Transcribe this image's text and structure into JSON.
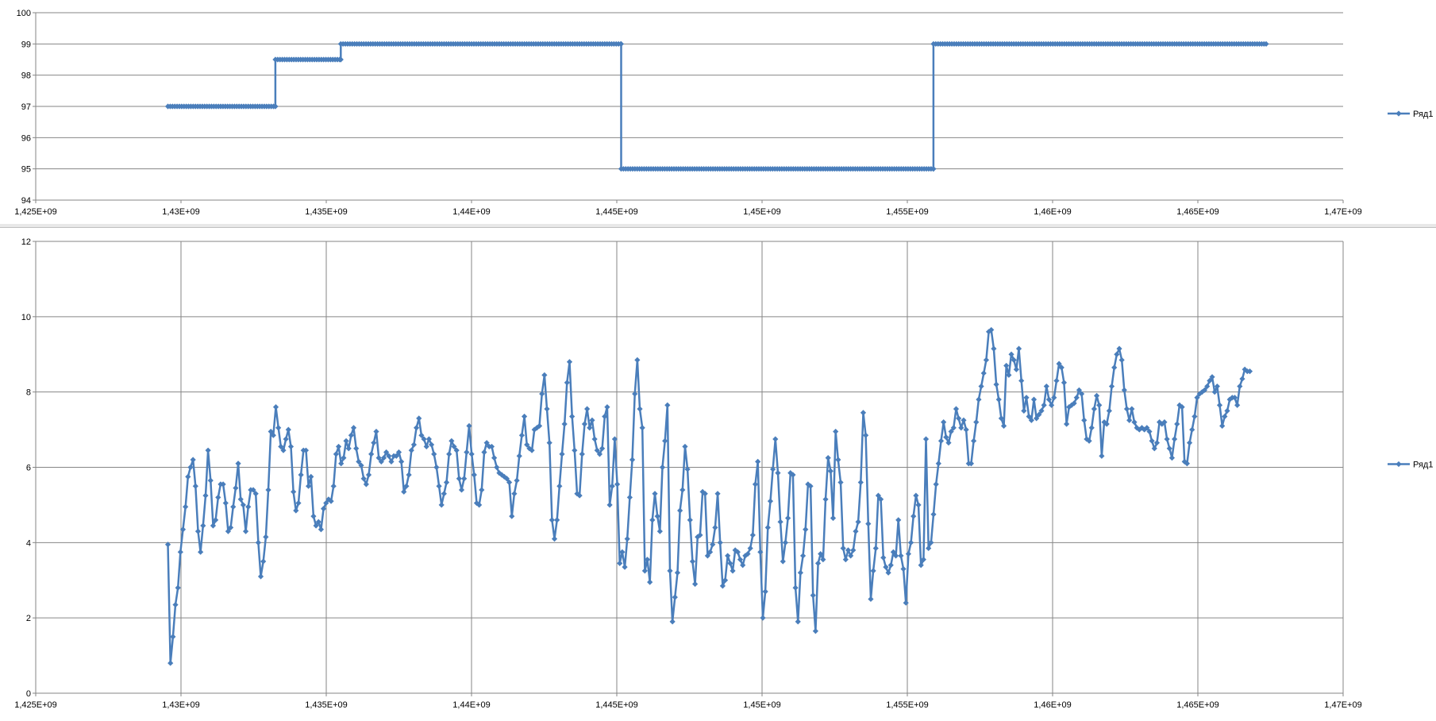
{
  "colors": {
    "series": "#4a7ebb",
    "grid": "#868686",
    "axis": "#868686"
  },
  "chart_data": [
    {
      "type": "line",
      "title": "",
      "xlabel": "",
      "ylabel": "",
      "xlim": [
        1425000000,
        1470000000
      ],
      "ylim": [
        94,
        100
      ],
      "grid": "horizontal",
      "legend_position": "right",
      "xtick_labels": [
        "1,425E+09",
        "1,43E+09",
        "1,435E+09",
        "1,44E+09",
        "1,445E+09",
        "1,45E+09",
        "1,455E+09",
        "1,46E+09",
        "1,465E+09",
        "1,47E+09"
      ],
      "ytick_labels": [
        "94",
        "95",
        "96",
        "97",
        "98",
        "99",
        "100"
      ],
      "series": [
        {
          "name": "Ряд1",
          "marker": "diamond",
          "x_start": 1429550000,
          "x_step": 79000,
          "steps": [
            {
              "x_from": 1429550000,
              "x_to": 1433250000,
              "y": 97
            },
            {
              "x_from": 1433250000,
              "x_to": 1435500000,
              "y": 98.5
            },
            {
              "x_from": 1435500000,
              "x_to": 1445150000,
              "y": 99
            },
            {
              "x_from": 1445150000,
              "x_to": 1455900000,
              "y": 95
            },
            {
              "x_from": 1455900000,
              "x_to": 1467350000,
              "y": 99
            }
          ]
        }
      ]
    },
    {
      "type": "line",
      "title": "",
      "xlabel": "",
      "ylabel": "",
      "xlim": [
        1425000000,
        1470000000
      ],
      "ylim": [
        0,
        12
      ],
      "grid": "both",
      "legend_position": "right",
      "xtick_labels": [
        "1,425E+09",
        "1,43E+09",
        "1,435E+09",
        "1,44E+09",
        "1,445E+09",
        "1,45E+09",
        "1,455E+09",
        "1,46E+09",
        "1,465E+09",
        "1,47E+09"
      ],
      "ytick_labels": [
        "0",
        "2",
        "4",
        "6",
        "8",
        "10",
        "12"
      ],
      "series": [
        {
          "name": "Ряд1",
          "marker": "diamond",
          "x_start": 1429550000,
          "x_step": 86400,
          "values": [
            3.95,
            0.8,
            1.5,
            2.35,
            2.8,
            3.75,
            4.35,
            4.95,
            5.75,
            6.0,
            6.2,
            5.5,
            4.3,
            3.75,
            4.45,
            5.25,
            6.45,
            5.65,
            4.45,
            4.6,
            5.2,
            5.55,
            5.55,
            5.05,
            4.3,
            4.4,
            4.95,
            5.45,
            6.1,
            5.15,
            5.0,
            4.3,
            4.95,
            5.4,
            5.4,
            5.3,
            4.0,
            3.1,
            3.5,
            4.15,
            5.4,
            6.95,
            6.85,
            7.6,
            7.05,
            6.55,
            6.45,
            6.75,
            7.0,
            6.55,
            5.35,
            4.85,
            5.05,
            5.8,
            6.45,
            6.45,
            5.5,
            5.75,
            4.7,
            4.45,
            4.55,
            4.35,
            4.9,
            5.05,
            5.15,
            5.1,
            5.5,
            6.35,
            6.55,
            6.1,
            6.25,
            6.7,
            6.5,
            6.85,
            7.05,
            6.5,
            6.15,
            6.05,
            5.7,
            5.55,
            5.8,
            6.35,
            6.65,
            6.95,
            6.25,
            6.15,
            6.25,
            6.4,
            6.3,
            6.15,
            6.3,
            6.3,
            6.4,
            6.15,
            5.35,
            5.5,
            5.8,
            6.45,
            6.6,
            7.05,
            7.3,
            6.85,
            6.75,
            6.55,
            6.75,
            6.6,
            6.35,
            6.0,
            5.5,
            5.0,
            5.3,
            5.6,
            6.35,
            6.7,
            6.55,
            6.45,
            5.7,
            5.4,
            5.7,
            6.4,
            7.1,
            6.35,
            5.8,
            5.05,
            5.0,
            5.4,
            6.4,
            6.65,
            6.55,
            6.55,
            6.25,
            6.0,
            5.85,
            5.8,
            5.75,
            5.7,
            5.6,
            4.7,
            5.3,
            5.65,
            6.3,
            6.85,
            7.35,
            6.6,
            6.5,
            6.45,
            7.0,
            7.05,
            7.1,
            7.95,
            8.45,
            7.55,
            6.65,
            4.6,
            4.1,
            4.6,
            5.5,
            6.35,
            7.15,
            8.25,
            8.8,
            7.35,
            6.45,
            5.3,
            5.25,
            6.35,
            7.15,
            7.55,
            7.05,
            7.25,
            6.75,
            6.45,
            6.35,
            6.5,
            7.35,
            7.6,
            5.0,
            5.5,
            6.75,
            5.55,
            3.45,
            3.75,
            3.35,
            4.1,
            5.2,
            6.2,
            7.95,
            8.85,
            7.55,
            7.05,
            3.25,
            3.55,
            2.95,
            4.6,
            5.3,
            4.7,
            4.3,
            6.0,
            6.7,
            7.65,
            3.25,
            1.9,
            2.55,
            3.2,
            4.85,
            5.4,
            6.55,
            5.95,
            4.6,
            3.5,
            2.9,
            4.15,
            4.2,
            5.35,
            5.3,
            3.65,
            3.75,
            3.95,
            4.4,
            5.3,
            4.0,
            2.85,
            3.0,
            3.65,
            3.45,
            3.25,
            3.8,
            3.75,
            3.55,
            3.4,
            3.65,
            3.7,
            3.85,
            4.2,
            5.55,
            6.15,
            3.75,
            2.0,
            2.7,
            4.4,
            5.1,
            5.95,
            6.75,
            5.85,
            4.55,
            3.5,
            4.0,
            4.65,
            5.85,
            5.8,
            2.8,
            1.9,
            3.2,
            3.65,
            4.35,
            5.55,
            5.5,
            2.6,
            1.65,
            3.45,
            3.7,
            3.55,
            5.15,
            6.25,
            5.9,
            4.65,
            6.95,
            6.2,
            5.6,
            3.85,
            3.55,
            3.8,
            3.65,
            3.8,
            4.3,
            4.55,
            5.6,
            7.45,
            6.85,
            4.5,
            2.5,
            3.25,
            3.85,
            5.25,
            5.15,
            3.6,
            3.35,
            3.2,
            3.4,
            3.75,
            3.65,
            4.6,
            3.65,
            3.3,
            2.4,
            3.7,
            4.0,
            4.7,
            5.25,
            5.0,
            3.4,
            3.55,
            6.75,
            3.85,
            4.0,
            4.75,
            5.55,
            6.1,
            6.7,
            7.2,
            6.8,
            6.65,
            6.95,
            7.05,
            7.55,
            7.3,
            7.05,
            7.25,
            7.0,
            6.1,
            6.1,
            6.7,
            7.2,
            7.8,
            8.15,
            8.5,
            8.85,
            9.6,
            9.65,
            9.15,
            8.2,
            7.8,
            7.3,
            7.1,
            8.7,
            8.45,
            9.0,
            8.85,
            8.6,
            9.15,
            8.3,
            7.5,
            7.85,
            7.35,
            7.25,
            7.8,
            7.3,
            7.4,
            7.5,
            7.65,
            8.15,
            7.8,
            7.65,
            7.85,
            8.3,
            8.75,
            8.65,
            8.25,
            7.15,
            7.6,
            7.65,
            7.7,
            7.85,
            8.05,
            7.95,
            7.25,
            6.75,
            6.7,
            7.05,
            7.55,
            7.9,
            7.65,
            6.3,
            7.2,
            7.15,
            7.5,
            8.15,
            8.65,
            9.0,
            9.15,
            8.85,
            8.05,
            7.55,
            7.25,
            7.55,
            7.2,
            7.05,
            7.0,
            7.05,
            7.0,
            7.05,
            6.95,
            6.7,
            6.5,
            6.65,
            7.2,
            7.15,
            7.2,
            6.75,
            6.5,
            6.25,
            6.75,
            7.15,
            7.65,
            7.6,
            6.15,
            6.1,
            6.65,
            7.0,
            7.35,
            7.85,
            7.95,
            8.0,
            8.05,
            8.15,
            8.3,
            8.4,
            8.0,
            8.15,
            7.65,
            7.1,
            7.35,
            7.5,
            7.8,
            7.85,
            7.85,
            7.65,
            8.15,
            8.35,
            8.6,
            8.55,
            8.55
          ]
        }
      ]
    }
  ]
}
